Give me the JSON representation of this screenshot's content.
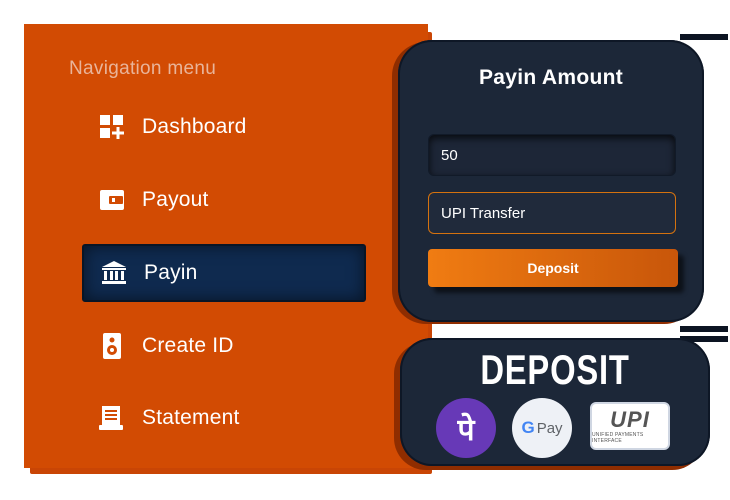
{
  "nav": {
    "heading": "Navigation menu",
    "items": [
      {
        "label": "Dashboard",
        "icon": "dashboard-icon",
        "active": false
      },
      {
        "label": "Payout",
        "icon": "wallet-icon",
        "active": false
      },
      {
        "label": "Payin",
        "icon": "bank-icon",
        "active": true
      },
      {
        "label": "Create ID",
        "icon": "speaker-icon",
        "active": false
      },
      {
        "label": "Statement",
        "icon": "document-icon",
        "active": false
      }
    ]
  },
  "payin": {
    "title": "Payin Amount",
    "amount_value": "50",
    "method_value": "UPI Transfer",
    "deposit_label": "Deposit"
  },
  "methods": {
    "title": "DEPOSIT",
    "phonepe_glyph": "पे",
    "gpay_text": "Pay",
    "gpay_g": "G",
    "upi_text": "UPI",
    "upi_sub": "UNIFIED PAYMENTS INTERFACE"
  },
  "colors": {
    "accent_orange": "#d24b03",
    "active_nav": "#0f2a4f",
    "card_bg": "#1c2738",
    "phonepe": "#6739b7"
  }
}
